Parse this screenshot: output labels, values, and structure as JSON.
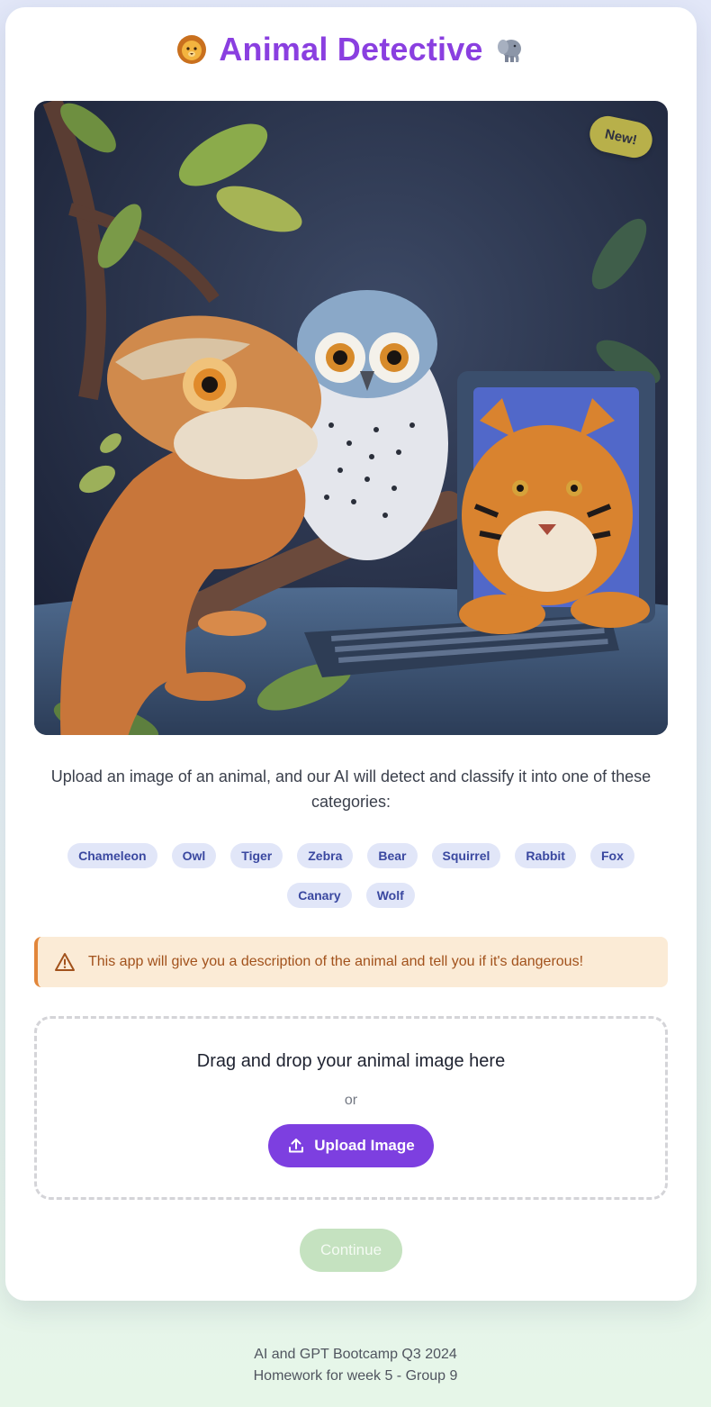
{
  "header": {
    "title": "Animal Detective",
    "left_icon": "lion-face-icon",
    "right_icon": "elephant-icon"
  },
  "hero": {
    "badge": "New!",
    "illustration": "hero-illustration"
  },
  "intro": {
    "text": "Upload an image of an animal, and our AI will detect and classify it into one of these categories:"
  },
  "categories": [
    "Chameleon",
    "Owl",
    "Tiger",
    "Zebra",
    "Bear",
    "Squirrel",
    "Rabbit",
    "Fox",
    "Canary",
    "Wolf"
  ],
  "alert": {
    "icon": "warning-triangle-icon",
    "text": "This app will give you a description of the animal and tell you if it's dangerous!"
  },
  "dropzone": {
    "title": "Drag and drop your animal image here",
    "or": "or",
    "upload_label": "Upload Image",
    "upload_icon": "upload-icon"
  },
  "actions": {
    "continue_label": "Continue"
  },
  "footer": {
    "line1": "AI and GPT Bootcamp Q3 2024",
    "line2": "Homework for week 5 - Group 9"
  },
  "colors": {
    "accent": "#8a3fe0",
    "button": "#7d3fe0",
    "continue_disabled": "#c5e2c0",
    "chip_bg": "#e1e6f8",
    "chip_text": "#3a48a0",
    "alert_bg": "#fbebd6",
    "alert_border": "#e2863a"
  }
}
